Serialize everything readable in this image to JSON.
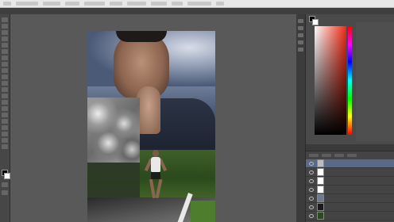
{
  "app": {
    "menu_items": [
      "文件",
      "编辑",
      "图像",
      "图层",
      "类型",
      "选择",
      "滤镜",
      "3D",
      "视图",
      "窗口",
      "帮助"
    ]
  },
  "document": {
    "tabs": []
  },
  "colors": {
    "foreground": "#000000",
    "background": "#ffffff",
    "accent_selected_layer": "#5a6a86"
  },
  "layers": [
    {
      "name": "",
      "visible": true
    },
    {
      "name": "",
      "visible": true
    },
    {
      "name": "",
      "visible": true
    },
    {
      "name": "",
      "visible": true
    },
    {
      "name": "",
      "visible": true
    },
    {
      "name": "",
      "visible": true
    },
    {
      "name": "",
      "visible": true
    }
  ]
}
